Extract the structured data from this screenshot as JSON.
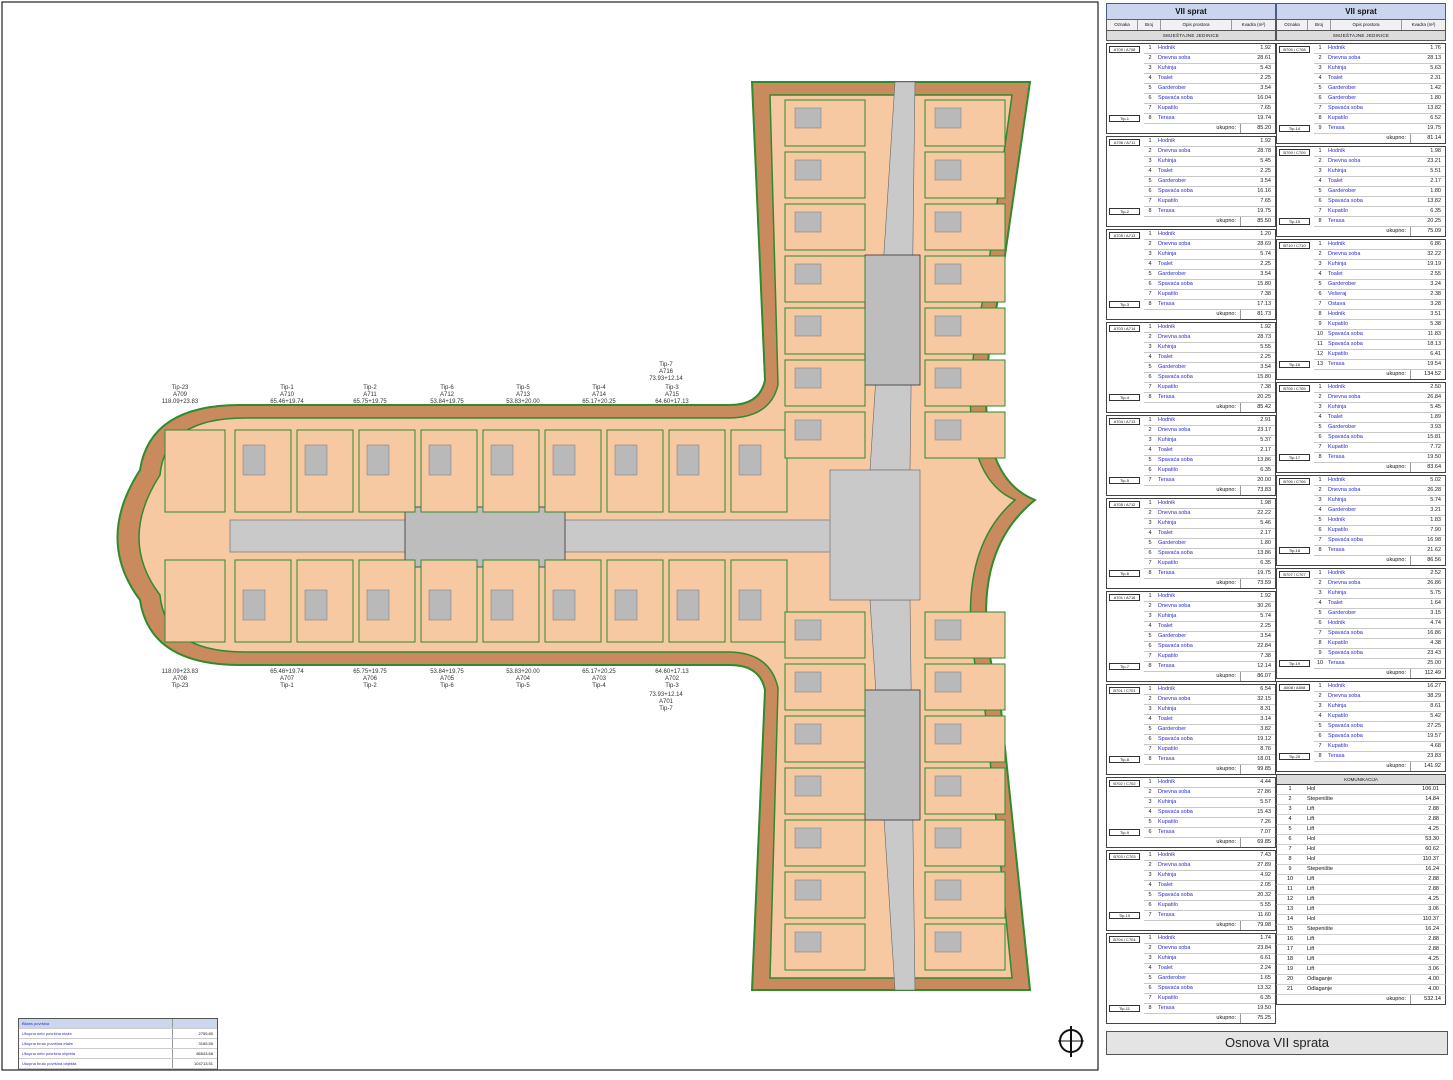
{
  "sheet_title": "Osnova VII sprata",
  "table": {
    "header": "VII sprat",
    "columns": [
      "Oznaka",
      "Broj",
      "Opis prostora",
      "Kvadra (m²)"
    ],
    "section_units": "SMJEŠTAJNE JEDINICE",
    "total_label": "ukupno:",
    "komunikacija_header": "KOMUNIKACIJA"
  },
  "units_left": [
    {
      "label": "A709\nA708",
      "tip": "Tip-1",
      "total": "85.20",
      "rows": [
        [
          "1",
          "Hodnik",
          "1.92"
        ],
        [
          "2",
          "Dnevna soba",
          "28.61"
        ],
        [
          "3",
          "Kuhinja",
          "5.43"
        ],
        [
          "4",
          "Toalet",
          "2.25"
        ],
        [
          "5",
          "Garderober",
          "3.54"
        ],
        [
          "6",
          "Spavaća soba",
          "16.04"
        ],
        [
          "7",
          "Kupatilo",
          "7.65"
        ],
        [
          "8",
          "Terasa",
          "19.74"
        ]
      ]
    },
    {
      "label": "A706\nA711",
      "tip": "Tip-2",
      "total": "85.50",
      "rows": [
        [
          "1",
          "Hodnik",
          "1.92"
        ],
        [
          "2",
          "Dnevna soba",
          "28.78"
        ],
        [
          "3",
          "Kuhinja",
          "5.45"
        ],
        [
          "4",
          "Toalet",
          "2.25"
        ],
        [
          "5",
          "Garderober",
          "3.54"
        ],
        [
          "6",
          "Spavaća soba",
          "16.16"
        ],
        [
          "7",
          "Kupatilo",
          "7.65"
        ],
        [
          "8",
          "Terasa",
          "19.75"
        ]
      ]
    },
    {
      "label": "A705\nA713",
      "tip": "Tip-3",
      "total": "81.73",
      "rows": [
        [
          "1",
          "Hodnik",
          "1.20"
        ],
        [
          "2",
          "Dnevna soba",
          "28.69"
        ],
        [
          "3",
          "Kuhinja",
          "5.74"
        ],
        [
          "4",
          "Toalet",
          "2.25"
        ],
        [
          "5",
          "Garderober",
          "3.54"
        ],
        [
          "6",
          "Spavaća soba",
          "15.80"
        ],
        [
          "7",
          "Kupatilo",
          "7.38"
        ],
        [
          "8",
          "Terasa",
          "17.13"
        ]
      ]
    },
    {
      "label": "A703\nA714",
      "tip": "Tip-4",
      "total": "85.42",
      "rows": [
        [
          "1",
          "Hodnik",
          "1.92"
        ],
        [
          "2",
          "Dnevna soba",
          "28.73"
        ],
        [
          "3",
          "Kuhinja",
          "5.55"
        ],
        [
          "4",
          "Toalet",
          "2.25"
        ],
        [
          "5",
          "Garderober",
          "3.54"
        ],
        [
          "6",
          "Spavaća soba",
          "15.80"
        ],
        [
          "7",
          "Kupatilo",
          "7.38"
        ],
        [
          "8",
          "Terasa",
          "20.25"
        ]
      ]
    },
    {
      "label": "A704\nA713",
      "tip": "Tip-5",
      "total": "73.83",
      "rows": [
        [
          "1",
          "Hodnik",
          "2.91"
        ],
        [
          "2",
          "Dnevna soba",
          "23.17"
        ],
        [
          "3",
          "Kuhinja",
          "5.37"
        ],
        [
          "4",
          "Toalet",
          "2.17"
        ],
        [
          "5",
          "Spavaća soba",
          "13.86"
        ],
        [
          "6",
          "Kupatilo",
          "6.35"
        ],
        [
          "7",
          "Terasa",
          "20.00"
        ]
      ]
    },
    {
      "label": "A705\nA712",
      "tip": "Tip-6",
      "total": "73.59",
      "rows": [
        [
          "1",
          "Hodnik",
          "1.98"
        ],
        [
          "2",
          "Dnevna soba",
          "22.22"
        ],
        [
          "3",
          "Kuhinja",
          "5.46"
        ],
        [
          "4",
          "Toalet",
          "2.17"
        ],
        [
          "5",
          "Garderober",
          "1.80"
        ],
        [
          "6",
          "Spavaća soba",
          "13.86"
        ],
        [
          "7",
          "Kupatilo",
          "6.35"
        ],
        [
          "8",
          "Terasa",
          "19.75"
        ]
      ]
    },
    {
      "label": "A701\nA716",
      "tip": "Tip-7",
      "total": "86.07",
      "rows": [
        [
          "1",
          "Hodnik",
          "1.92"
        ],
        [
          "2",
          "Dnevna soba",
          "30.26"
        ],
        [
          "3",
          "Kuhinja",
          "5.74"
        ],
        [
          "4",
          "Toalet",
          "2.25"
        ],
        [
          "5",
          "Garderober",
          "3.54"
        ],
        [
          "6",
          "Spavaća soba",
          "22.84"
        ],
        [
          "7",
          "Kupatilo",
          "7.38"
        ],
        [
          "8",
          "Terasa",
          "12.14"
        ]
      ]
    },
    {
      "label": "B701\nC701",
      "tip": "Tip-8",
      "total": "99.85",
      "rows": [
        [
          "1",
          "Hodnik",
          "6.54"
        ],
        [
          "2",
          "Dnevna soba",
          "32.15"
        ],
        [
          "3",
          "Kuhinja",
          "8.31"
        ],
        [
          "4",
          "Toalet",
          "3.14"
        ],
        [
          "5",
          "Garderober",
          "3.82"
        ],
        [
          "6",
          "Spavaća soba",
          "19.12"
        ],
        [
          "7",
          "Kupatilo",
          "8.76"
        ],
        [
          "8",
          "Terasa",
          "18.01"
        ]
      ]
    },
    {
      "label": "B702\nC702",
      "tip": "Tip-9",
      "total": "69.85",
      "rows": [
        [
          "1",
          "Hodnik",
          "4.44"
        ],
        [
          "2",
          "Dnevna soba",
          "27.86"
        ],
        [
          "3",
          "Kuhinja",
          "5.57"
        ],
        [
          "4",
          "Spavaća soba",
          "15.43"
        ],
        [
          "5",
          "Kupatilo",
          "7.26"
        ],
        [
          "6",
          "Terasa",
          "7.07"
        ]
      ]
    },
    {
      "label": "B703\nC703",
      "tip": "Tip-10",
      "total": "79.98",
      "rows": [
        [
          "1",
          "Hodnik",
          "7.43"
        ],
        [
          "2",
          "Dnevna soba",
          "27.89"
        ],
        [
          "3",
          "Kuhinja",
          "4.92"
        ],
        [
          "4",
          "Toalet",
          "2.05"
        ],
        [
          "5",
          "Spavaća soba",
          "20.32"
        ],
        [
          "6",
          "Kupatilo",
          "5.55"
        ],
        [
          "7",
          "Terasa",
          "11.60"
        ]
      ]
    },
    {
      "label": "B704\nC704",
      "tip": "Tip-11",
      "total": "75.25",
      "rows": [
        [
          "1",
          "Hodnik",
          "1.74"
        ],
        [
          "2",
          "Dnevna soba",
          "23.84"
        ],
        [
          "3",
          "Kuhinja",
          "6.61"
        ],
        [
          "4",
          "Toalet",
          "2.24"
        ],
        [
          "5",
          "Garderober",
          "1.65"
        ],
        [
          "6",
          "Spavaća soba",
          "13.32"
        ],
        [
          "7",
          "Kupatilo",
          "6.35"
        ],
        [
          "8",
          "Terasa",
          "19.50"
        ]
      ]
    }
  ],
  "units_right": [
    {
      "label": "B705\nC708",
      "tip": "Tip-14",
      "total": "81.14",
      "rows": [
        [
          "1",
          "Hodnik",
          "1.76"
        ],
        [
          "2",
          "Dnevna soba",
          "28.13"
        ],
        [
          "3",
          "Kuhinja",
          "5.63"
        ],
        [
          "4",
          "Toalet",
          "2.31"
        ],
        [
          "5",
          "Garderober",
          "1.42"
        ],
        [
          "6",
          "Garderober",
          "1.80"
        ],
        [
          "7",
          "Spavaća soba",
          "13.82"
        ],
        [
          "8",
          "Kupatilo",
          "6.52"
        ],
        [
          "9",
          "Terasa",
          "19.75"
        ]
      ]
    },
    {
      "label": "B709\nC709",
      "tip": "Tip-15",
      "total": "75.09",
      "rows": [
        [
          "1",
          "Hodnik",
          "1.98"
        ],
        [
          "2",
          "Dnevna soba",
          "23.21"
        ],
        [
          "3",
          "Kuhinja",
          "5.51"
        ],
        [
          "4",
          "Toalet",
          "2.17"
        ],
        [
          "5",
          "Garderober",
          "1.80"
        ],
        [
          "6",
          "Spavaća soba",
          "13.82"
        ],
        [
          "7",
          "Kupatilo",
          "6.35"
        ],
        [
          "8",
          "Terasa",
          "20.25"
        ]
      ]
    },
    {
      "label": "B710\nC710",
      "tip": "Tip-16",
      "total": "134.52",
      "rows": [
        [
          "1",
          "Hodnik",
          "6.86"
        ],
        [
          "2",
          "Dnevna soba",
          "32.22"
        ],
        [
          "3",
          "Kuhinja",
          "19.19"
        ],
        [
          "4",
          "Toalet",
          "2.55"
        ],
        [
          "5",
          "Garderober",
          "3.24"
        ],
        [
          "6",
          "Vešeraj",
          "2.38"
        ],
        [
          "7",
          "Ostava",
          "3.28"
        ],
        [
          "8",
          "Hodnik",
          "3.51"
        ],
        [
          "9",
          "Kupatilo",
          "5.38"
        ],
        [
          "10",
          "Spavaća soba",
          "11.83"
        ],
        [
          "11",
          "Spavaća soba",
          "18.13"
        ],
        [
          "12",
          "Kupatilo",
          "6.41"
        ],
        [
          "13",
          "Terasa",
          "19.54"
        ]
      ]
    },
    {
      "label": "B705\nC705",
      "tip": "Tip-17",
      "total": "83.64",
      "rows": [
        [
          "1",
          "Hodnik",
          "2.50"
        ],
        [
          "2",
          "Dnevna soba",
          "26.84"
        ],
        [
          "3",
          "Kuhinja",
          "5.45"
        ],
        [
          "4",
          "Toalet",
          "1.89"
        ],
        [
          "5",
          "Garderober",
          "3.93"
        ],
        [
          "6",
          "Spavaća soba",
          "15.81"
        ],
        [
          "7",
          "Kupatilo",
          "7.72"
        ],
        [
          "8",
          "Terasa",
          "19.50"
        ]
      ]
    },
    {
      "label": "B706\nC706",
      "tip": "Tip-18",
      "total": "86.56",
      "rows": [
        [
          "1",
          "Hodnik",
          "5.02"
        ],
        [
          "2",
          "Dnevna soba",
          "26.28"
        ],
        [
          "3",
          "Kuhinja",
          "5.74"
        ],
        [
          "4",
          "Garderober",
          "3.21"
        ],
        [
          "5",
          "Hodnik",
          "1.83"
        ],
        [
          "6",
          "Kupatilo",
          "7.90"
        ],
        [
          "7",
          "Spavaća soba",
          "16.98"
        ],
        [
          "8",
          "Terasa",
          "21.62"
        ]
      ]
    },
    {
      "label": "B707\nC707",
      "tip": "Tip-19",
      "total": "112.49",
      "rows": [
        [
          "1",
          "Hodnik",
          "2.52"
        ],
        [
          "2",
          "Dnevna soba",
          "26.86"
        ],
        [
          "3",
          "Kuhinja",
          "5.75"
        ],
        [
          "4",
          "Toalet",
          "1.64"
        ],
        [
          "5",
          "Garderober",
          "3.15"
        ],
        [
          "6",
          "Hodnik",
          "4.74"
        ],
        [
          "7",
          "Spavaća soba",
          "16.86"
        ],
        [
          "8",
          "Kupatilo",
          "4.38"
        ],
        [
          "9",
          "Spavaća soba",
          "23.43"
        ],
        [
          "10",
          "Terasa",
          "25.00"
        ]
      ]
    },
    {
      "label": "A508\nA508",
      "tip": "Tip-20",
      "total": "141.92",
      "rows": [
        [
          "1",
          "Hodnik",
          "16.27"
        ],
        [
          "2",
          "Dnevna soba",
          "38.29"
        ],
        [
          "3",
          "Kuhinja",
          "8.61"
        ],
        [
          "4",
          "Kupatilo",
          "5.42"
        ],
        [
          "5",
          "Spavaća soba",
          "27.25"
        ],
        [
          "6",
          "Spavaća soba",
          "19.57"
        ],
        [
          "7",
          "Kupatilo",
          "4.68"
        ],
        [
          "8",
          "Terasa",
          "23.83"
        ]
      ]
    }
  ],
  "komunikacija": {
    "total": "532.14",
    "rows": [
      [
        "1",
        "Hol",
        "106.01"
      ],
      [
        "2",
        "Stepenište",
        "14.84"
      ],
      [
        "3",
        "Lift",
        "2.88"
      ],
      [
        "4",
        "Lift",
        "2.88"
      ],
      [
        "5",
        "Lift",
        "4.25"
      ],
      [
        "6",
        "Hol",
        "53.30"
      ],
      [
        "7",
        "Hol",
        "60.62"
      ],
      [
        "8",
        "Hol",
        "110.37"
      ],
      [
        "9",
        "Stepenište",
        "16.24"
      ],
      [
        "10",
        "Lift",
        "2.88"
      ],
      [
        "11",
        "Lift",
        "2.88"
      ],
      [
        "12",
        "Lift",
        "4.25"
      ],
      [
        "13",
        "Lift",
        "3.06"
      ],
      [
        "14",
        "Hol",
        "110.37"
      ],
      [
        "15",
        "Stepenište",
        "16.24"
      ],
      [
        "16",
        "Lift",
        "2.88"
      ],
      [
        "17",
        "Lift",
        "2.88"
      ],
      [
        "18",
        "Lift",
        "4.25"
      ],
      [
        "19",
        "Lift",
        "3.06"
      ],
      [
        "20",
        "Odlaganje",
        "4.00"
      ],
      [
        "21",
        "Odlaganje",
        "4.00"
      ]
    ]
  },
  "legend_rows": [
    [
      "Bilans površina",
      ""
    ],
    [
      "Ukupna neto površina etaže",
      "2755.80"
    ],
    [
      "Ukupna bruto površina etaže",
      "3165.55"
    ],
    [
      "Ukupna neto površina objekta",
      "86543.68"
    ],
    [
      "Ukupna bruto površina objekta",
      "104713.51"
    ]
  ],
  "plan_labels": {
    "top": [
      [
        "Tip-23",
        "A709",
        "118.09+23.83"
      ],
      [
        "Tip-1",
        "A710",
        "65.46+19.74"
      ],
      [
        "Tip-2",
        "A711",
        "65.75+19.75"
      ],
      [
        "Tip-6",
        "A712",
        "53.84+19.75"
      ],
      [
        "Tip-5",
        "A713",
        "53.83+20.00"
      ],
      [
        "Tip-4",
        "A714",
        "65.17+20.25"
      ],
      [
        "Tip-3",
        "A715",
        "64.60+17.13"
      ]
    ],
    "bottom": [
      [
        "118.09+23.83",
        "A708",
        "Tip-23"
      ],
      [
        "65.46+19.74",
        "A707",
        "Tip-1"
      ],
      [
        "65.75+19.75",
        "A706",
        "Tip-2"
      ],
      [
        "53.84+19.75",
        "A705",
        "Tip-6"
      ],
      [
        "53.83+20.00",
        "A704",
        "Tip-5"
      ],
      [
        "65.17+20.25",
        "A703",
        "Tip-4"
      ],
      [
        "64.60+17.13",
        "A702",
        "Tip-3"
      ]
    ],
    "tip7_top": [
      "Tip-7",
      "A716",
      "73.93+12.14"
    ],
    "tip7_bottom": [
      "73.93+12.14",
      "A701",
      "Tip-7"
    ]
  },
  "colors": {
    "terrace": "#c98b5e",
    "room": "#f6c9a2",
    "corridor": "#c9c9c9",
    "wall": "#2e8b2e",
    "accent": "#2a2ad0"
  }
}
